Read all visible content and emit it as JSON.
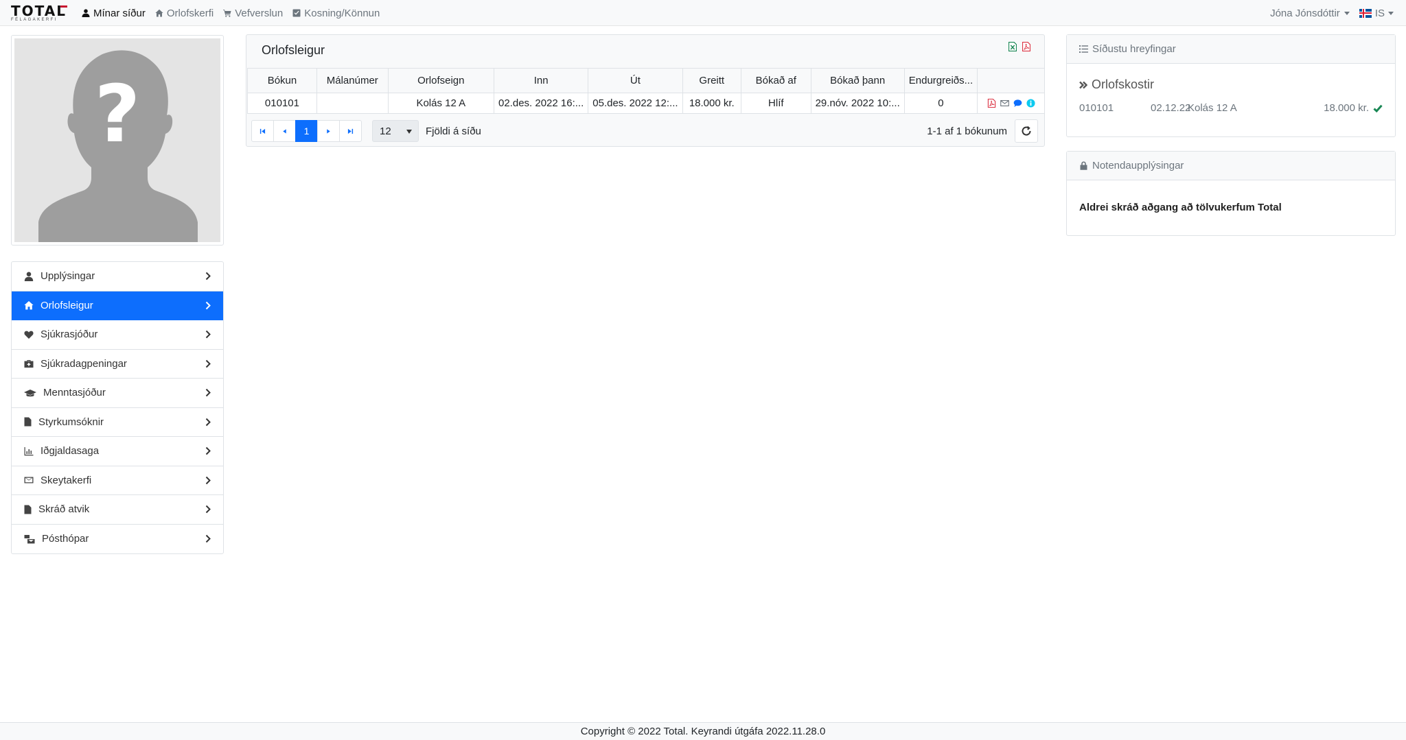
{
  "brand": {
    "main": "TOTAL",
    "sub": "FÉLAGAKERFI"
  },
  "nav": {
    "links": [
      {
        "label": "Mínar síður",
        "icon": "user-icon"
      },
      {
        "label": "Orlofskerfi",
        "icon": "home-icon"
      },
      {
        "label": "Vefverslun",
        "icon": "cart-icon"
      },
      {
        "label": "Kosning/Könnun",
        "icon": "check-square-icon"
      }
    ],
    "user_name": "Jóna Jónsdóttir",
    "language": "IS"
  },
  "sidebar": {
    "items": [
      {
        "label": "Upplýsingar",
        "icon": "user-icon"
      },
      {
        "label": "Orlofsleigur",
        "icon": "home-icon",
        "active": true
      },
      {
        "label": "Sjúkrasjóður",
        "icon": "heartbeat-icon"
      },
      {
        "label": "Sjúkradagpeningar",
        "icon": "medkit-icon"
      },
      {
        "label": "Menntasjóður",
        "icon": "graduation-cap-icon"
      },
      {
        "label": "Styrkumsóknir",
        "icon": "file-icon"
      },
      {
        "label": "Iðgjaldasaga",
        "icon": "bar-chart-icon"
      },
      {
        "label": "Skeytakerfi",
        "icon": "envelope-icon"
      },
      {
        "label": "Skráð atvik",
        "icon": "file-icon"
      },
      {
        "label": "Pósthópar",
        "icon": "mail-bulk-icon"
      }
    ]
  },
  "main": {
    "title": "Orlofsleigur",
    "table": {
      "headers": [
        "Bókun",
        "Málanúmer",
        "Orlofseign",
        "Inn",
        "Út",
        "Greitt",
        "Bókað af",
        "Bókað þann",
        "Endurgreiðs..."
      ],
      "rows": [
        [
          "010101",
          "",
          "Kolás 12 A",
          "02.des. 2022 16:...",
          "05.des. 2022 12:...",
          "18.000 kr.",
          "Hlíf",
          "29.nóv. 2022 10:...",
          "0"
        ]
      ]
    },
    "pager": {
      "current_page": "1",
      "page_size": "12",
      "page_size_label": "Fjöldi á síðu",
      "info": "1-1 af 1 bókunum"
    }
  },
  "recent": {
    "title": "Síðustu hreyfingar",
    "subtitle": "Orlofskostir",
    "row": {
      "id": "010101",
      "date": "02.12.22",
      "place": "Kolás 12 A",
      "amount": "18.000 kr."
    }
  },
  "user_info": {
    "title": "Notendaupplýsingar",
    "message": "Aldrei skráð aðgang að tölvukerfum Total"
  },
  "footer": {
    "text": "Copyright © 2022 Total. Keyrandi útgáfa 2022.11.28.0"
  },
  "colors": {
    "primary": "#0d6efd",
    "success": "#198754",
    "danger": "#dc3545",
    "info": "#0dcaf0"
  }
}
